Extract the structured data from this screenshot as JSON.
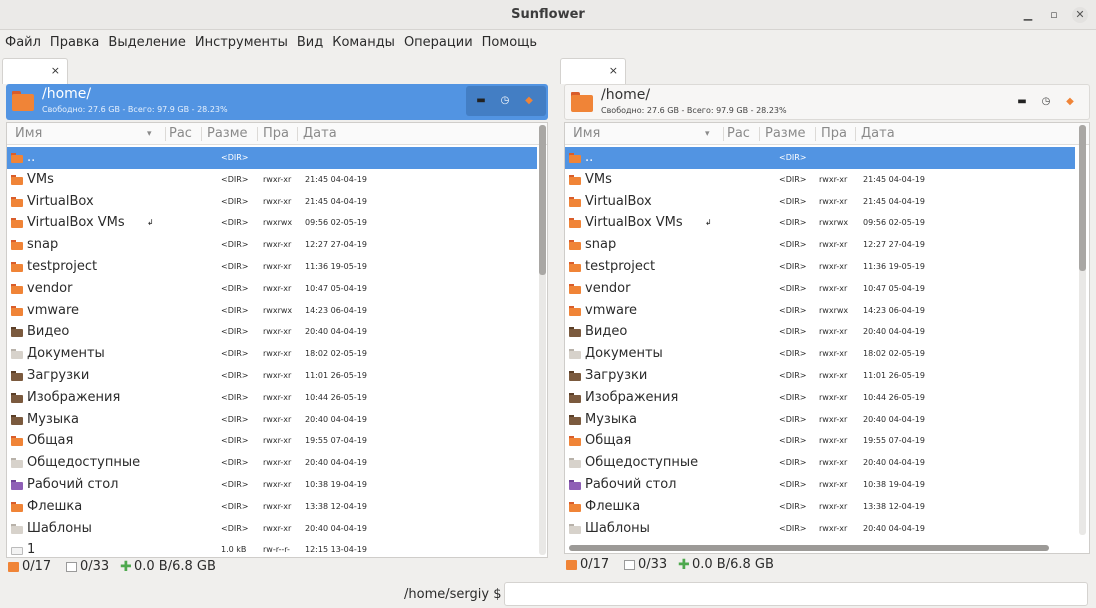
{
  "window": {
    "title": "Sunflower"
  },
  "menu": [
    "Файл",
    "Правка",
    "Выделение",
    "Инструменты",
    "Вид",
    "Команды",
    "Операции",
    "Помощь"
  ],
  "columns": {
    "name": "Имя",
    "ext": "Рас",
    "size": "Разме",
    "perm": "Пра",
    "date": "Дата"
  },
  "panels": [
    {
      "tab_close": "×",
      "path": "/home/",
      "info": "Свободно: 27.6 GB - Всего: 97.9 GB - 28.23%",
      "status": {
        "folders": "0/17",
        "files": "0/33",
        "size": "0.0 B/6.8 GB"
      }
    },
    {
      "tab_close": "×",
      "path": "/home/",
      "info": "Свободно: 27.6 GB - Всего: 97.9 GB - 28.23%",
      "status": {
        "folders": "0/17",
        "files": "0/33",
        "size": "0.0 B/6.8 GB"
      }
    }
  ],
  "rows": [
    {
      "name": "..",
      "size": "<DIR>",
      "perm": "",
      "date": "",
      "icon": "folder"
    },
    {
      "name": "VMs",
      "size": "<DIR>",
      "perm": "rwxr-xr",
      "date": "21:45 04-04-19",
      "icon": "folder"
    },
    {
      "name": "VirtualBox",
      "size": "<DIR>",
      "perm": "rwxr-xr",
      "date": "21:45 04-04-19",
      "icon": "folder"
    },
    {
      "name": "VirtualBox VMs",
      "size": "<DIR>",
      "perm": "rwxrwx",
      "date": "09:56 02-05-19",
      "icon": "folder",
      "link": "↲"
    },
    {
      "name": "snap",
      "size": "<DIR>",
      "perm": "rwxr-xr",
      "date": "12:27 27-04-19",
      "icon": "folder"
    },
    {
      "name": "testproject",
      "size": "<DIR>",
      "perm": "rwxr-xr",
      "date": "11:36 19-05-19",
      "icon": "folder"
    },
    {
      "name": "vendor",
      "size": "<DIR>",
      "perm": "rwxr-xr",
      "date": "10:47 05-04-19",
      "icon": "folder"
    },
    {
      "name": "vmware",
      "size": "<DIR>",
      "perm": "rwxrwx",
      "date": "14:23 06-04-19",
      "icon": "folder"
    },
    {
      "name": "Видео",
      "size": "<DIR>",
      "perm": "rwxr-xr",
      "date": "20:40 04-04-19",
      "icon": "dark"
    },
    {
      "name": "Документы",
      "size": "<DIR>",
      "perm": "rwxr-xr",
      "date": "18:02 02-05-19",
      "icon": "doc"
    },
    {
      "name": "Загрузки",
      "size": "<DIR>",
      "perm": "rwxr-xr",
      "date": "11:01 26-05-19",
      "icon": "dark"
    },
    {
      "name": "Изображения",
      "size": "<DIR>",
      "perm": "rwxr-xr",
      "date": "10:44 26-05-19",
      "icon": "dark"
    },
    {
      "name": "Музыка",
      "size": "<DIR>",
      "perm": "rwxr-xr",
      "date": "20:40 04-04-19",
      "icon": "dark"
    },
    {
      "name": "Общая",
      "size": "<DIR>",
      "perm": "rwxr-xr",
      "date": "19:55 07-04-19",
      "icon": "folder"
    },
    {
      "name": "Общедоступные",
      "size": "<DIR>",
      "perm": "rwxr-xr",
      "date": "20:40 04-04-19",
      "icon": "doc"
    },
    {
      "name": "Рабочий стол",
      "size": "<DIR>",
      "perm": "rwxr-xr",
      "date": "10:38 19-04-19",
      "icon": "purple"
    },
    {
      "name": "Флешка",
      "size": "<DIR>",
      "perm": "rwxr-xr",
      "date": "13:38 12-04-19",
      "icon": "folder"
    },
    {
      "name": "Шаблоны",
      "size": "<DIR>",
      "perm": "rwxr-xr",
      "date": "20:40 04-04-19",
      "icon": "doc"
    },
    {
      "name": "1",
      "size": "1.0 kB",
      "perm": "rw-r--r-",
      "date": "12:15 13-04-19",
      "icon": "file"
    }
  ],
  "commandline": {
    "prompt": "/home/sergiy $",
    "value": ""
  }
}
